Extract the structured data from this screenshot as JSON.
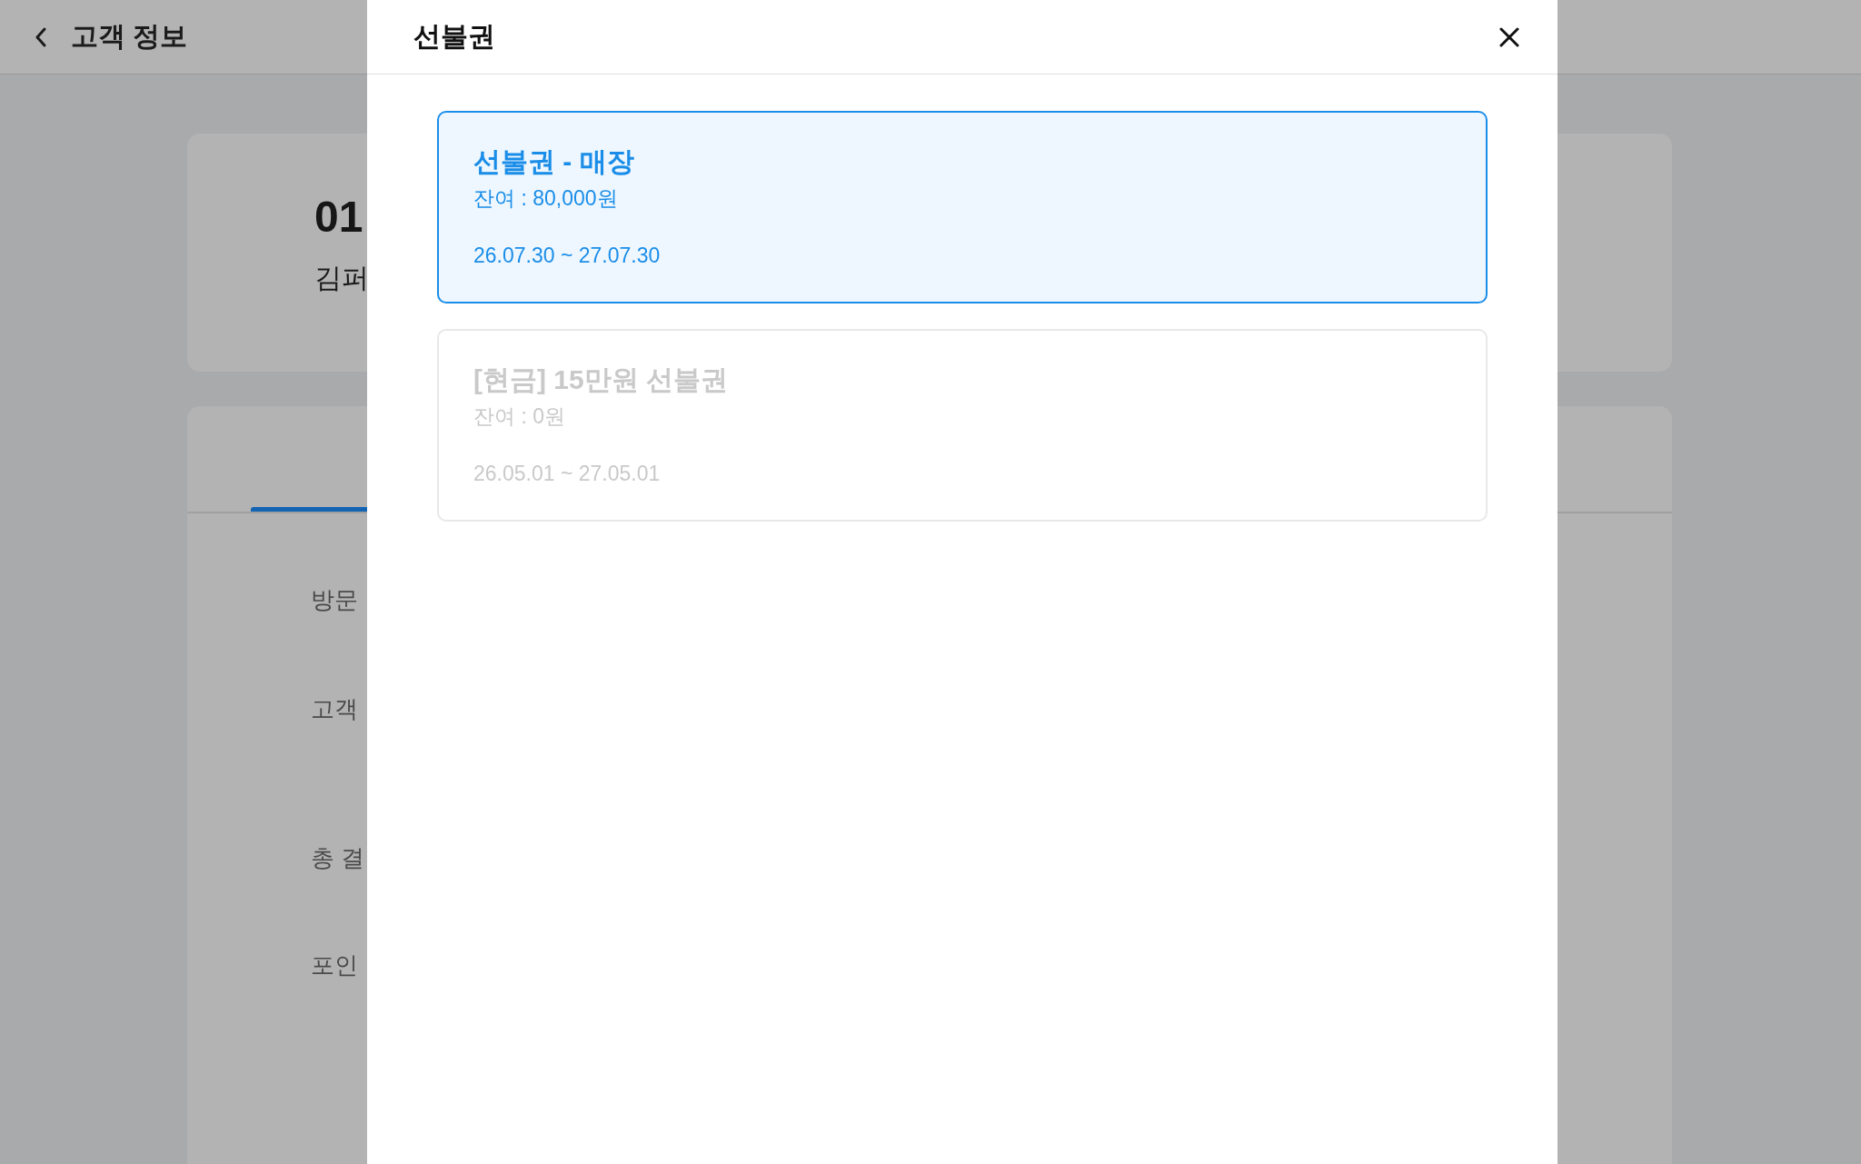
{
  "page": {
    "title": "고객 정보",
    "customer_card": {
      "number": "01",
      "name": "김퍼"
    },
    "info_labels": [
      "방문",
      "고객",
      "총 결",
      "포인"
    ]
  },
  "modal": {
    "title": "선불권",
    "tickets": [
      {
        "name": "선불권 - 매장",
        "balance": "잔여 : 80,000원",
        "period": "26.07.30 ~ 27.07.30",
        "selected": true,
        "disabled": false
      },
      {
        "name": "[현금] 15만원 선불권",
        "balance": "잔여 : 0원",
        "period": "26.05.01 ~ 27.05.01",
        "selected": false,
        "disabled": true
      }
    ]
  }
}
